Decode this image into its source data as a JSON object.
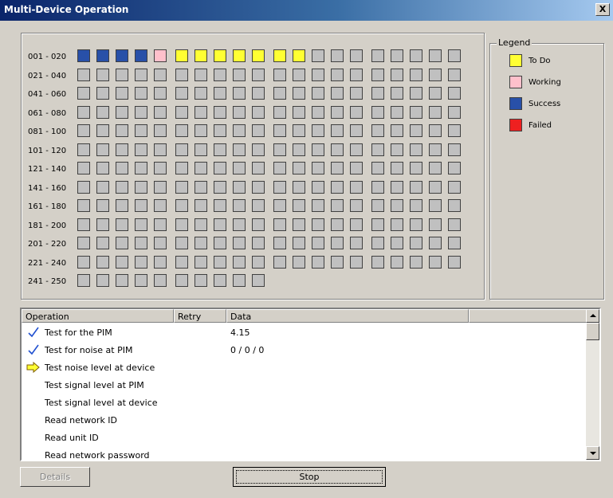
{
  "window": {
    "title": "Multi-Device Operation",
    "close_label": "X"
  },
  "grid": {
    "rows": [
      {
        "label": "001 - 020",
        "states": [
          3,
          3,
          3,
          3,
          2,
          1,
          1,
          1,
          1,
          1,
          1,
          1,
          0,
          0,
          0,
          0,
          0,
          0,
          0,
          0
        ]
      },
      {
        "label": "021 - 040",
        "states": [
          0,
          0,
          0,
          0,
          0,
          0,
          0,
          0,
          0,
          0,
          0,
          0,
          0,
          0,
          0,
          0,
          0,
          0,
          0,
          0
        ]
      },
      {
        "label": "041 - 060",
        "states": [
          0,
          0,
          0,
          0,
          0,
          0,
          0,
          0,
          0,
          0,
          0,
          0,
          0,
          0,
          0,
          0,
          0,
          0,
          0,
          0
        ]
      },
      {
        "label": "061 - 080",
        "states": [
          0,
          0,
          0,
          0,
          0,
          0,
          0,
          0,
          0,
          0,
          0,
          0,
          0,
          0,
          0,
          0,
          0,
          0,
          0,
          0
        ]
      },
      {
        "label": "081 - 100",
        "states": [
          0,
          0,
          0,
          0,
          0,
          0,
          0,
          0,
          0,
          0,
          0,
          0,
          0,
          0,
          0,
          0,
          0,
          0,
          0,
          0
        ]
      },
      {
        "label": "101 - 120",
        "states": [
          0,
          0,
          0,
          0,
          0,
          0,
          0,
          0,
          0,
          0,
          0,
          0,
          0,
          0,
          0,
          0,
          0,
          0,
          0,
          0
        ]
      },
      {
        "label": "121 - 140",
        "states": [
          0,
          0,
          0,
          0,
          0,
          0,
          0,
          0,
          0,
          0,
          0,
          0,
          0,
          0,
          0,
          0,
          0,
          0,
          0,
          0
        ]
      },
      {
        "label": "141 - 160",
        "states": [
          0,
          0,
          0,
          0,
          0,
          0,
          0,
          0,
          0,
          0,
          0,
          0,
          0,
          0,
          0,
          0,
          0,
          0,
          0,
          0
        ]
      },
      {
        "label": "161 - 180",
        "states": [
          0,
          0,
          0,
          0,
          0,
          0,
          0,
          0,
          0,
          0,
          0,
          0,
          0,
          0,
          0,
          0,
          0,
          0,
          0,
          0
        ]
      },
      {
        "label": "181 - 200",
        "states": [
          0,
          0,
          0,
          0,
          0,
          0,
          0,
          0,
          0,
          0,
          0,
          0,
          0,
          0,
          0,
          0,
          0,
          0,
          0,
          0
        ]
      },
      {
        "label": "201 - 220",
        "states": [
          0,
          0,
          0,
          0,
          0,
          0,
          0,
          0,
          0,
          0,
          0,
          0,
          0,
          0,
          0,
          0,
          0,
          0,
          0,
          0
        ]
      },
      {
        "label": "221 - 240",
        "states": [
          0,
          0,
          0,
          0,
          0,
          0,
          0,
          0,
          0,
          0,
          0,
          0,
          0,
          0,
          0,
          0,
          0,
          0,
          0,
          0
        ]
      },
      {
        "label": "241 - 250",
        "states": [
          0,
          0,
          0,
          0,
          0,
          0,
          0,
          0,
          0,
          0
        ]
      }
    ]
  },
  "legend": {
    "title": "Legend",
    "items": [
      {
        "label": "To Do",
        "color": "#ffff33"
      },
      {
        "label": "Working",
        "color": "#ffc0cb"
      },
      {
        "label": "Success",
        "color": "#2850a8"
      },
      {
        "label": "Failed",
        "color": "#ee2020"
      }
    ]
  },
  "operations": {
    "columns": [
      "Operation",
      "Retry",
      "Data",
      ""
    ],
    "rows": [
      {
        "icon": "checkmark-icon",
        "operation": "Test for the PIM",
        "retry": "",
        "data": "4.15"
      },
      {
        "icon": "checkmark-icon",
        "operation": "Test for noise at PIM",
        "retry": "",
        "data": "0 / 0 / 0"
      },
      {
        "icon": "arrow-right-icon",
        "operation": "Test noise level at device",
        "retry": "",
        "data": ""
      },
      {
        "icon": "",
        "operation": "Test signal level at PIM",
        "retry": "",
        "data": ""
      },
      {
        "icon": "",
        "operation": "Test signal level at device",
        "retry": "",
        "data": ""
      },
      {
        "icon": "",
        "operation": "Read network ID",
        "retry": "",
        "data": ""
      },
      {
        "icon": "",
        "operation": "Read unit ID",
        "retry": "",
        "data": ""
      },
      {
        "icon": "",
        "operation": "Read network password",
        "retry": "",
        "data": ""
      }
    ]
  },
  "buttons": {
    "details": "Details",
    "stop": "Stop"
  }
}
